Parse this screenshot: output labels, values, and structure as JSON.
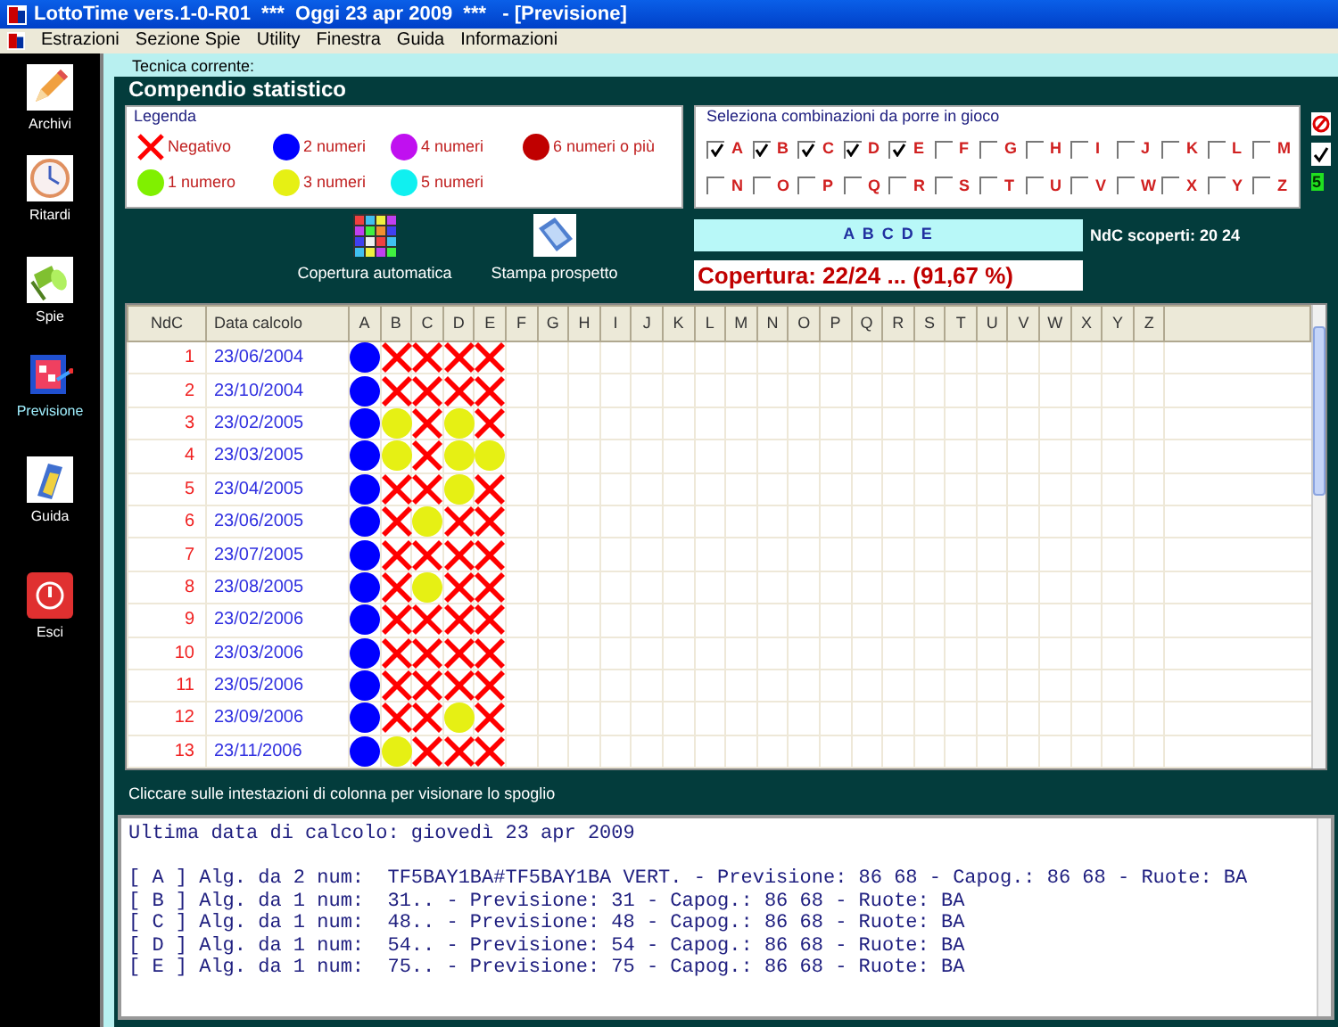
{
  "window": {
    "title": "LottoTime vers.1-0-R01  ***  Oggi 23 apr 2009  ***   - [Previsione]"
  },
  "menu": [
    "Estrazioni",
    "Sezione Spie",
    "Utility",
    "Finestra",
    "Guida",
    "Informazioni"
  ],
  "sidebar": [
    {
      "label": "Archivi",
      "kind": "pencil",
      "selected": false
    },
    {
      "label": "Ritardi",
      "kind": "clock",
      "selected": false
    },
    {
      "label": "Spie",
      "kind": "torch",
      "selected": false
    },
    {
      "label": "Previsione",
      "kind": "forecast",
      "selected": true
    },
    {
      "label": "Guida",
      "kind": "book",
      "selected": false
    },
    {
      "label": "Esci",
      "kind": "exit",
      "selected": false
    }
  ],
  "technique_label": "Tecnica corrente:",
  "panel_title": "Compendio statistico",
  "legend": {
    "title": "Legenda",
    "items": [
      {
        "kind": "neg",
        "label": "Negativo",
        "color": "#ff0000"
      },
      {
        "kind": "n2",
        "label": "2 numeri",
        "color": "#0000ff"
      },
      {
        "kind": "n4",
        "label": "4 numeri",
        "color": "#c010f0"
      },
      {
        "kind": "n6",
        "label": "6 numeri o più",
        "color": "#c00000"
      },
      {
        "kind": "n1",
        "label": "1 numero",
        "color": "#80f000"
      },
      {
        "kind": "n3",
        "label": "3 numeri",
        "color": "#e6f014"
      },
      {
        "kind": "n5",
        "label": "5 numeri",
        "color": "#10f0f0"
      }
    ]
  },
  "selection": {
    "title": "Seleziona combinazioni da porre in gioco",
    "count": "5",
    "options": [
      {
        "label": "A",
        "checked": true
      },
      {
        "label": "B",
        "checked": true
      },
      {
        "label": "C",
        "checked": true
      },
      {
        "label": "D",
        "checked": true
      },
      {
        "label": "E",
        "checked": true
      },
      {
        "label": "F",
        "checked": false
      },
      {
        "label": "G",
        "checked": false
      },
      {
        "label": "H",
        "checked": false
      },
      {
        "label": "I",
        "checked": false
      },
      {
        "label": "J",
        "checked": false
      },
      {
        "label": "K",
        "checked": false
      },
      {
        "label": "L",
        "checked": false
      },
      {
        "label": "M",
        "checked": false
      },
      {
        "label": "N",
        "checked": false
      },
      {
        "label": "O",
        "checked": false
      },
      {
        "label": "P",
        "checked": false
      },
      {
        "label": "Q",
        "checked": false
      },
      {
        "label": "R",
        "checked": false
      },
      {
        "label": "S",
        "checked": false
      },
      {
        "label": "T",
        "checked": false
      },
      {
        "label": "U",
        "checked": false
      },
      {
        "label": "V",
        "checked": false
      },
      {
        "label": "W",
        "checked": false
      },
      {
        "label": "X",
        "checked": false
      },
      {
        "label": "Y",
        "checked": false
      },
      {
        "label": "Z",
        "checked": false
      }
    ]
  },
  "actions": [
    {
      "label": "Copertura automatica",
      "kind": "grid"
    },
    {
      "label": "Stampa prospetto",
      "kind": "print"
    }
  ],
  "combination": "A B C D E",
  "uncovered": "NdC scoperti: 20 24",
  "coverage": "Copertura: 22/24 ... (91,67 %)",
  "table": {
    "columns": [
      "NdC",
      "Data calcolo",
      "A",
      "B",
      "C",
      "D",
      "E",
      "F",
      "G",
      "H",
      "I",
      "J",
      "K",
      "L",
      "M",
      "N",
      "O",
      "P",
      "Q",
      "R",
      "S",
      "T",
      "U",
      "V",
      "W",
      "X",
      "Y",
      "Z"
    ],
    "rows": [
      {
        "ndc": "1",
        "date": "23/06/2004",
        "cells": [
          {
            "kind": "n2"
          },
          {
            "kind": "neg"
          },
          {
            "kind": "neg"
          },
          {
            "kind": "neg"
          },
          {
            "kind": "neg"
          }
        ]
      },
      {
        "ndc": "2",
        "date": "23/10/2004",
        "cells": [
          {
            "kind": "n2"
          },
          {
            "kind": "neg"
          },
          {
            "kind": "neg"
          },
          {
            "kind": "neg"
          },
          {
            "kind": "neg"
          }
        ]
      },
      {
        "ndc": "3",
        "date": "23/02/2005",
        "cells": [
          {
            "kind": "n2"
          },
          {
            "kind": "n3"
          },
          {
            "kind": "neg"
          },
          {
            "kind": "n3"
          },
          {
            "kind": "neg"
          }
        ]
      },
      {
        "ndc": "4",
        "date": "23/03/2005",
        "cells": [
          {
            "kind": "n2"
          },
          {
            "kind": "n3"
          },
          {
            "kind": "neg"
          },
          {
            "kind": "n3"
          },
          {
            "kind": "n3"
          }
        ]
      },
      {
        "ndc": "5",
        "date": "23/04/2005",
        "cells": [
          {
            "kind": "n2"
          },
          {
            "kind": "neg"
          },
          {
            "kind": "neg"
          },
          {
            "kind": "n3"
          },
          {
            "kind": "neg"
          }
        ]
      },
      {
        "ndc": "6",
        "date": "23/06/2005",
        "cells": [
          {
            "kind": "n2"
          },
          {
            "kind": "neg"
          },
          {
            "kind": "n3"
          },
          {
            "kind": "neg"
          },
          {
            "kind": "neg"
          }
        ]
      },
      {
        "ndc": "7",
        "date": "23/07/2005",
        "cells": [
          {
            "kind": "n2"
          },
          {
            "kind": "neg"
          },
          {
            "kind": "neg"
          },
          {
            "kind": "neg"
          },
          {
            "kind": "neg"
          }
        ]
      },
      {
        "ndc": "8",
        "date": "23/08/2005",
        "cells": [
          {
            "kind": "n2"
          },
          {
            "kind": "neg"
          },
          {
            "kind": "n3"
          },
          {
            "kind": "neg"
          },
          {
            "kind": "neg"
          }
        ]
      },
      {
        "ndc": "9",
        "date": "23/02/2006",
        "cells": [
          {
            "kind": "n2"
          },
          {
            "kind": "neg"
          },
          {
            "kind": "neg"
          },
          {
            "kind": "neg"
          },
          {
            "kind": "neg"
          }
        ]
      },
      {
        "ndc": "10",
        "date": "23/03/2006",
        "cells": [
          {
            "kind": "n2"
          },
          {
            "kind": "neg"
          },
          {
            "kind": "neg"
          },
          {
            "kind": "neg"
          },
          {
            "kind": "neg"
          }
        ]
      },
      {
        "ndc": "11",
        "date": "23/05/2006",
        "cells": [
          {
            "kind": "n2"
          },
          {
            "kind": "neg"
          },
          {
            "kind": "neg"
          },
          {
            "kind": "neg"
          },
          {
            "kind": "neg"
          }
        ]
      },
      {
        "ndc": "12",
        "date": "23/09/2006",
        "cells": [
          {
            "kind": "n2"
          },
          {
            "kind": "neg"
          },
          {
            "kind": "neg"
          },
          {
            "kind": "n3"
          },
          {
            "kind": "neg"
          }
        ]
      },
      {
        "ndc": "13",
        "date": "23/11/2006",
        "cells": [
          {
            "kind": "n2"
          },
          {
            "kind": "n3"
          },
          {
            "kind": "neg"
          },
          {
            "kind": "neg"
          },
          {
            "kind": "neg"
          }
        ]
      }
    ]
  },
  "hint": "Cliccare sulle intestazioni di colonna per visionare lo spoglio",
  "output": [
    "Ultima data di calcolo: giovedì 23 apr 2009",
    "[ A ] Alg. da 2 num:  TF5BAY1BA#TF5BAY1BA VERT. - Previsione: 86 68 - Capog.: 86 68 - Ruote: BA",
    "[ B ] Alg. da 1 num:  31.. - Previsione: 31 - Capog.: 86 68 - Ruote: BA",
    "[ C ] Alg. da 1 num:  48.. - Previsione: 48 - Capog.: 86 68 - Ruote: BA",
    "[ D ] Alg. da 1 num:  54.. - Previsione: 54 - Capog.: 86 68 - Ruote: BA",
    "[ E ] Alg. da 1 num:  75.. - Previsione: 75 - Capog.: 86 68 - Ruote: BA"
  ]
}
